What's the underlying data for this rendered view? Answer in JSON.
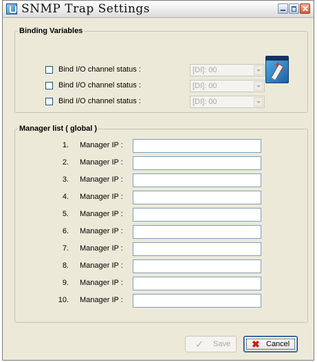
{
  "window": {
    "title": "SNMP Trap Settings"
  },
  "binding_group": {
    "legend": "Binding Variables",
    "rows": [
      {
        "label": "Bind I/O channel status :",
        "checked": false,
        "value": "[DI]: 00",
        "enabled": false
      },
      {
        "label": "Bind I/O channel status :",
        "checked": false,
        "value": "[DI]: 00",
        "enabled": false
      },
      {
        "label": "Bind I/O channel status :",
        "checked": false,
        "value": "[DI]: 00",
        "enabled": false
      }
    ]
  },
  "manager_group": {
    "legend": "Manager list ( global )",
    "rows": [
      {
        "num": "1.",
        "label": "Manager IP :",
        "value": ""
      },
      {
        "num": "2.",
        "label": "Manager IP :",
        "value": ""
      },
      {
        "num": "3.",
        "label": "Manager IP :",
        "value": ""
      },
      {
        "num": "4.",
        "label": "Manager IP :",
        "value": ""
      },
      {
        "num": "5.",
        "label": "Manager IP :",
        "value": ""
      },
      {
        "num": "6.",
        "label": "Manager IP :",
        "value": ""
      },
      {
        "num": "7.",
        "label": "Manager IP :",
        "value": ""
      },
      {
        "num": "8.",
        "label": "Manager IP :",
        "value": ""
      },
      {
        "num": "9.",
        "label": "Manager IP :",
        "value": ""
      },
      {
        "num": "10.",
        "label": "Manager IP :",
        "value": ""
      }
    ]
  },
  "buttons": {
    "save_label": "Save",
    "save_enabled": false,
    "cancel_label": "Cancel"
  },
  "icons": {
    "app": "snmp-app-icon",
    "settings": "tools-icon",
    "save": "checkmark-icon",
    "cancel": "x-icon"
  },
  "colors": {
    "window_bg": "#ece9d8",
    "input_border": "#7f9db9",
    "cancel_icon": "#d11a1a"
  }
}
